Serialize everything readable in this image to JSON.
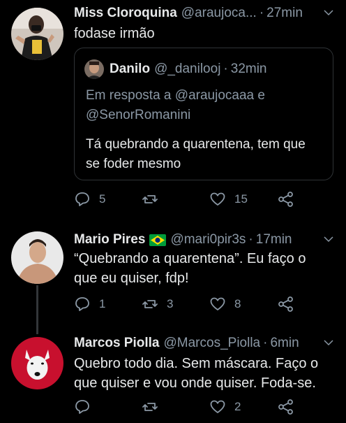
{
  "tweets": [
    {
      "name": "Miss Cloroquina",
      "handle": "@araujoca...",
      "time": "27min",
      "text": "fodase irmão",
      "quote": {
        "name": "Danilo",
        "handle": "@_danilooj",
        "time": "32min",
        "reply_line1": "Em resposta a @araujocaaa e",
        "reply_line2": "@SenorRomanini",
        "text_line1": "Tá quebrando a quarentena, tem que",
        "text_line2": "se foder mesmo"
      },
      "replies": "5",
      "retweets": "",
      "likes": "15"
    },
    {
      "name": "Mario Pires",
      "handle": "@mari0pir3s",
      "time": "17min",
      "text_line1": "“Quebrando a quarentena”. Eu faço o",
      "text_line2": "que eu quiser, fdp!",
      "replies": "1",
      "retweets": "3",
      "likes": "8"
    },
    {
      "name": "Marcos Piolla",
      "handle": "@Marcos_Piolla",
      "time": "6min",
      "text_line1": "Quebro todo dia. Sem máscara. Faço o",
      "text_line2": "que quiser e vou onde quiser. Foda-se.",
      "replies": "",
      "retweets": "",
      "likes": "2"
    }
  ],
  "separator": "·",
  "icons": [
    "reply-icon",
    "retweet-icon",
    "like-icon",
    "share-icon",
    "chevron-down-icon",
    "brazil-flag-icon"
  ],
  "colors": {
    "background": "#000000",
    "text": "#e7e9ea",
    "secondary": "#8b98a5",
    "border": "#2f3336"
  }
}
